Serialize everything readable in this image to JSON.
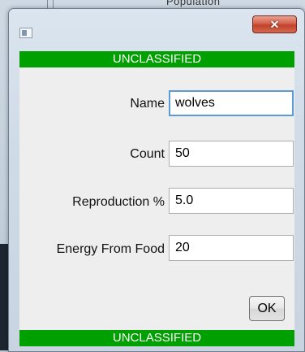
{
  "background": {
    "label": "Population"
  },
  "window": {
    "title_icon": "app-window-icon",
    "close_icon": "close-icon",
    "close_glyph": "✕"
  },
  "banner": {
    "top_text": "UNCLASSIFIED",
    "bottom_text": "UNCLASSIFIED",
    "color": "#00a000"
  },
  "form": {
    "fields": [
      {
        "label": "Name",
        "value": "wolves"
      },
      {
        "label": "Count",
        "value": "50"
      },
      {
        "label": "Reproduction %",
        "value": "5.0"
      },
      {
        "label": "Energy From Food",
        "value": "20"
      }
    ],
    "ok_label": "OK"
  }
}
